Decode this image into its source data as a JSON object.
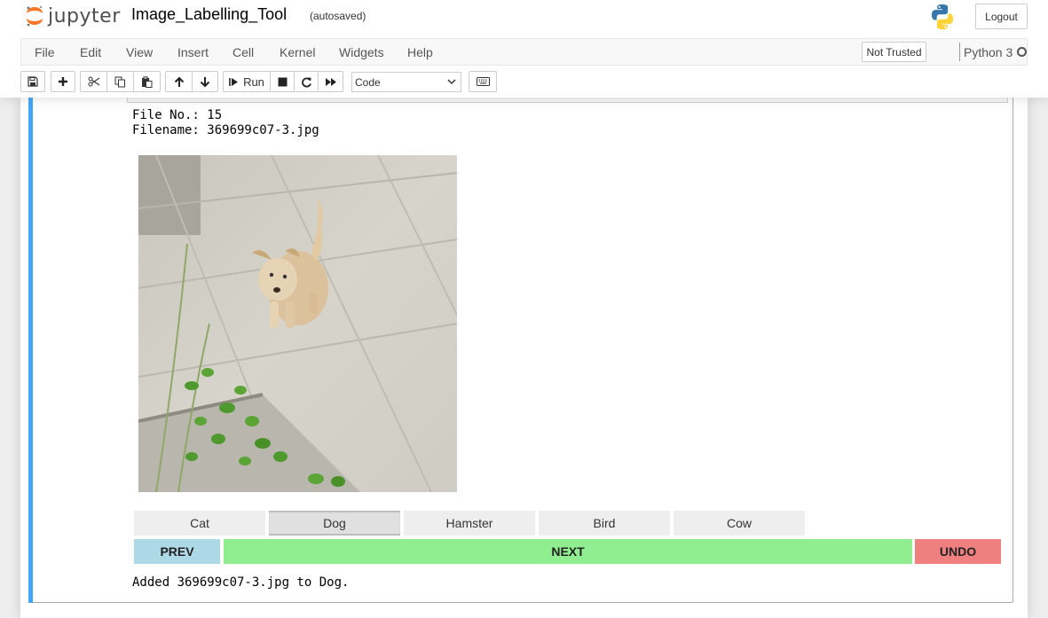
{
  "header": {
    "logo_text": "jupyter",
    "notebook_title": "Image_Labelling_Tool",
    "autosave_status": "(autosaved)",
    "logout_label": "Logout"
  },
  "menubar": {
    "items": [
      "File",
      "Edit",
      "View",
      "Insert",
      "Cell",
      "Kernel",
      "Widgets",
      "Help"
    ],
    "trust_status": "Not Trusted",
    "kernel_name": "Python 3"
  },
  "toolbar": {
    "run_label": "Run",
    "cell_type": "Code",
    "icons": [
      "save-icon",
      "plus-icon",
      "cut-icon",
      "copy-icon",
      "paste-icon",
      "arrow-up-icon",
      "arrow-down-icon",
      "step-forward-icon",
      "stop-icon",
      "redo-icon",
      "fast-forward-icon",
      "keyboard-icon"
    ]
  },
  "output": {
    "file_no_line": "File No.: 15",
    "filename_line": "Filename: 369699c07-3.jpg",
    "image_alt": "photo of a puppy on tiled floor",
    "labels": [
      "Cat",
      "Dog",
      "Hamster",
      "Bird",
      "Cow"
    ],
    "selected_label": "Dog",
    "prev_label": "PREV",
    "next_label": "NEXT",
    "undo_label": "UNDO",
    "status_message": "Added 369699c07-3.jpg to Dog."
  },
  "colors": {
    "cell_selected_bar": "#42a5f5",
    "prev_button": "#add8e6",
    "next_button": "#90ee90",
    "undo_button": "#f08080",
    "jupyter_orange": "#f37726"
  }
}
